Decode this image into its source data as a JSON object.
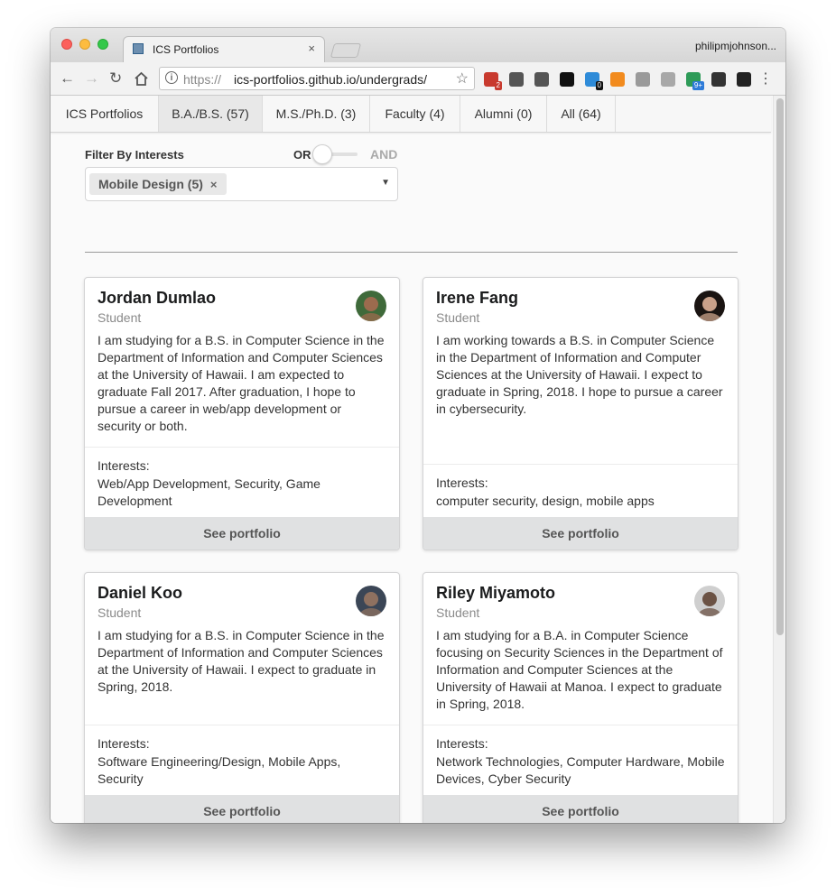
{
  "browser": {
    "tab_title": "ICS Portfolios",
    "tab_close": "×",
    "profile_name": "philipmjohnson...",
    "url_scheme": "https://",
    "url_host_path": "ics-portfolios.github.io/undergrads/",
    "extensions": [
      {
        "name": "lastpass-icon",
        "color": "#c83a2e",
        "badge": "2"
      },
      {
        "name": "sync-icon",
        "color": "#555555",
        "badge": ""
      },
      {
        "name": "info-circle-icon",
        "color": "#555555",
        "badge": ""
      },
      {
        "name": "jetbrains-icon",
        "color": "#111111",
        "badge": ""
      },
      {
        "name": "ghostery-icon",
        "color": "#2e8bd8",
        "badge": "0"
      },
      {
        "name": "analytics-chart-icon",
        "color": "#f28b1e",
        "badge": ""
      },
      {
        "name": "gray-ext-icon",
        "color": "#9a9a9a",
        "badge": ""
      },
      {
        "name": "drive-icon",
        "color": "#a8a8a8",
        "badge": ""
      },
      {
        "name": "green-ext-icon",
        "color": "#2e9b58",
        "badge": "9+"
      },
      {
        "name": "eyedropper-icon",
        "color": "#333333",
        "badge": ""
      },
      {
        "name": "color-wheel-icon",
        "color": "#222222",
        "badge": ""
      }
    ]
  },
  "nav": {
    "items": [
      {
        "label": "ICS Portfolios",
        "active": false
      },
      {
        "label": "B.A./B.S. (57)",
        "active": true
      },
      {
        "label": "M.S./Ph.D. (3)",
        "active": false
      },
      {
        "label": "Faculty (4)",
        "active": false
      },
      {
        "label": "Alumni (0)",
        "active": false
      },
      {
        "label": "All (64)",
        "active": false
      }
    ]
  },
  "filter": {
    "label": "Filter By Interests",
    "or_label": "OR",
    "and_label": "AND",
    "selected_chip": "Mobile Design (5)",
    "chip_remove": "×",
    "dropdown_arrow": "▼"
  },
  "cards": [
    {
      "name": "Jordan Dumlao",
      "role": "Student",
      "description": "I am studying for a B.S. in Computer Science in the Department of Information and Computer Sciences at the University of Hawaii. I am expected to graduate Fall 2017. After graduation, I hope to pursue a career in web/app development or security or both.",
      "interests_label": "Interests:",
      "interests": "Web/App Development, Security, Game Development",
      "button": "See portfolio",
      "avatar_colors": [
        "#3f6a3a",
        "#9c6b4e"
      ]
    },
    {
      "name": "Irene Fang",
      "role": "Student",
      "description": "I am working towards a B.S. in Computer Science in the Department of Information and Computer Sciences at the University of Hawaii. I expect to graduate in Spring, 2018. I hope to pursue a career in cybersecurity.",
      "interests_label": "Interests:",
      "interests": "computer security, design, mobile apps",
      "button": "See portfolio",
      "avatar_colors": [
        "#1a1412",
        "#c9a18a"
      ]
    },
    {
      "name": "Daniel Koo",
      "role": "Student",
      "description": "I am studying for a B.S. in Computer Science in the Department of Information and Computer Sciences at the University of Hawaii. I expect to graduate in Spring, 2018.",
      "interests_label": "Interests:",
      "interests": "Software Engineering/Design, Mobile Apps, Security",
      "button": "See portfolio",
      "avatar_colors": [
        "#3b4656",
        "#8f7160"
      ]
    },
    {
      "name": "Riley Miyamoto",
      "role": "Student",
      "description": "I am studying for a B.A. in Computer Science focusing on Security Sciences in the Department of Information and Computer Sciences at the University of Hawaii at Manoa. I expect to graduate in Spring, 2018.",
      "interests_label": "Interests:",
      "interests": "Network Technologies, Computer Hardware, Mobile Devices, Cyber Security",
      "button": "See portfolio",
      "avatar_colors": [
        "#cfcfcf",
        "#6b5244"
      ]
    }
  ]
}
